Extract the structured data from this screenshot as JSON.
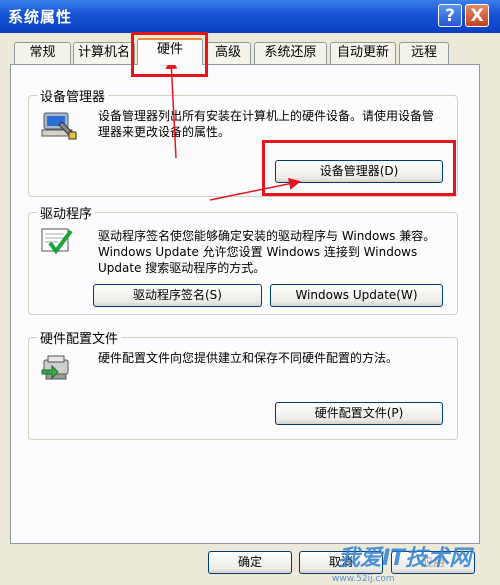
{
  "window": {
    "title": "系统属性",
    "help_glyph": "?",
    "close_glyph": "X"
  },
  "tabs": [
    {
      "label": "常规"
    },
    {
      "label": "计算机名"
    },
    {
      "label": "硬件",
      "active": true
    },
    {
      "label": "高级"
    },
    {
      "label": "系统还原"
    },
    {
      "label": "自动更新"
    },
    {
      "label": "远程"
    }
  ],
  "device_manager": {
    "group_title": "设备管理器",
    "description": "设备管理器列出所有安装在计算机上的硬件设备。请使用设备管理器来更改设备的属性。",
    "button_label": "设备管理器(D)",
    "icon": "device-manager-icon"
  },
  "drivers": {
    "group_title": "驱动程序",
    "description": "驱动程序签名使您能够确定安装的驱动程序与 Windows 兼容。Windows Update 允许您设置 Windows 连接到 Windows Update 搜索驱动程序的方式。",
    "signing_button_label": "驱动程序签名(S)",
    "update_button_label": "Windows Update(W)",
    "icon": "driver-signing-icon"
  },
  "hardware_profiles": {
    "group_title": "硬件配置文件",
    "description": "硬件配置文件向您提供建立和保存不同硬件配置的方法。",
    "button_label": "硬件配置文件(P)",
    "icon": "hardware-profile-icon"
  },
  "footer": {
    "ok_label": "确定",
    "cancel_label": "取消",
    "apply_label": "应用"
  },
  "watermark": {
    "brand": "我爱IT技术网",
    "url": "www.52ij.com"
  },
  "colors": {
    "highlight": "#e8141c",
    "title_bar": "#1652d6",
    "active_tab_accent": "#e68b2c"
  }
}
